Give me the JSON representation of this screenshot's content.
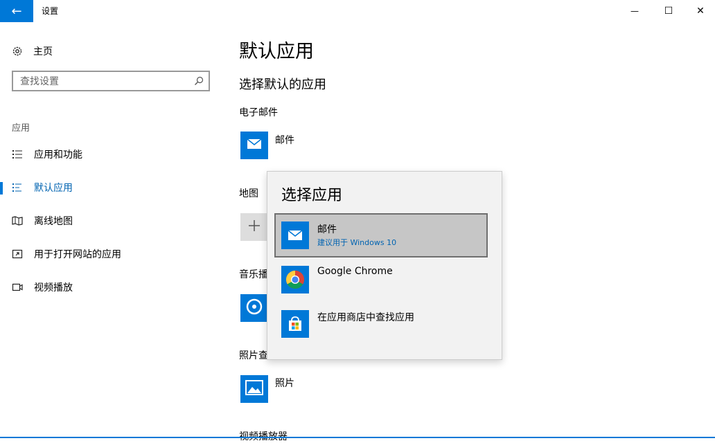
{
  "window": {
    "title": "设置",
    "back_glyph": "←",
    "minimize_glyph": "—",
    "maximize_glyph": "☐",
    "close_glyph": "✕",
    "accent": "#0078d7"
  },
  "sidebar": {
    "home_label": "主页",
    "search_placeholder": "查找设置",
    "section_label": "应用",
    "items": [
      {
        "label": "应用和功能",
        "icon": "apps-list-icon"
      },
      {
        "label": "默认应用",
        "icon": "default-apps-icon",
        "active": true
      },
      {
        "label": "离线地图",
        "icon": "offline-maps-icon"
      },
      {
        "label": "用于打开网站的应用",
        "icon": "open-website-icon"
      },
      {
        "label": "视频播放",
        "icon": "video-playback-icon"
      }
    ]
  },
  "main": {
    "title": "默认应用",
    "subtitle": "选择默认的应用",
    "categories": [
      {
        "label": "电子邮件",
        "app": "邮件"
      },
      {
        "label": "地图",
        "app": ""
      },
      {
        "label": "音乐播",
        "app": ""
      },
      {
        "label": "照片查",
        "app": "照片"
      },
      {
        "label": "视频播放器",
        "app": ""
      }
    ]
  },
  "flyout": {
    "title": "选择应用",
    "items": [
      {
        "name": "邮件",
        "sub": "建议用于 Windows 10",
        "icon": "mail-icon",
        "selected": true
      },
      {
        "name": "Google Chrome",
        "sub": "",
        "icon": "chrome-icon"
      },
      {
        "name": "在应用商店中查找应用",
        "sub": "",
        "icon": "store-icon"
      }
    ]
  }
}
